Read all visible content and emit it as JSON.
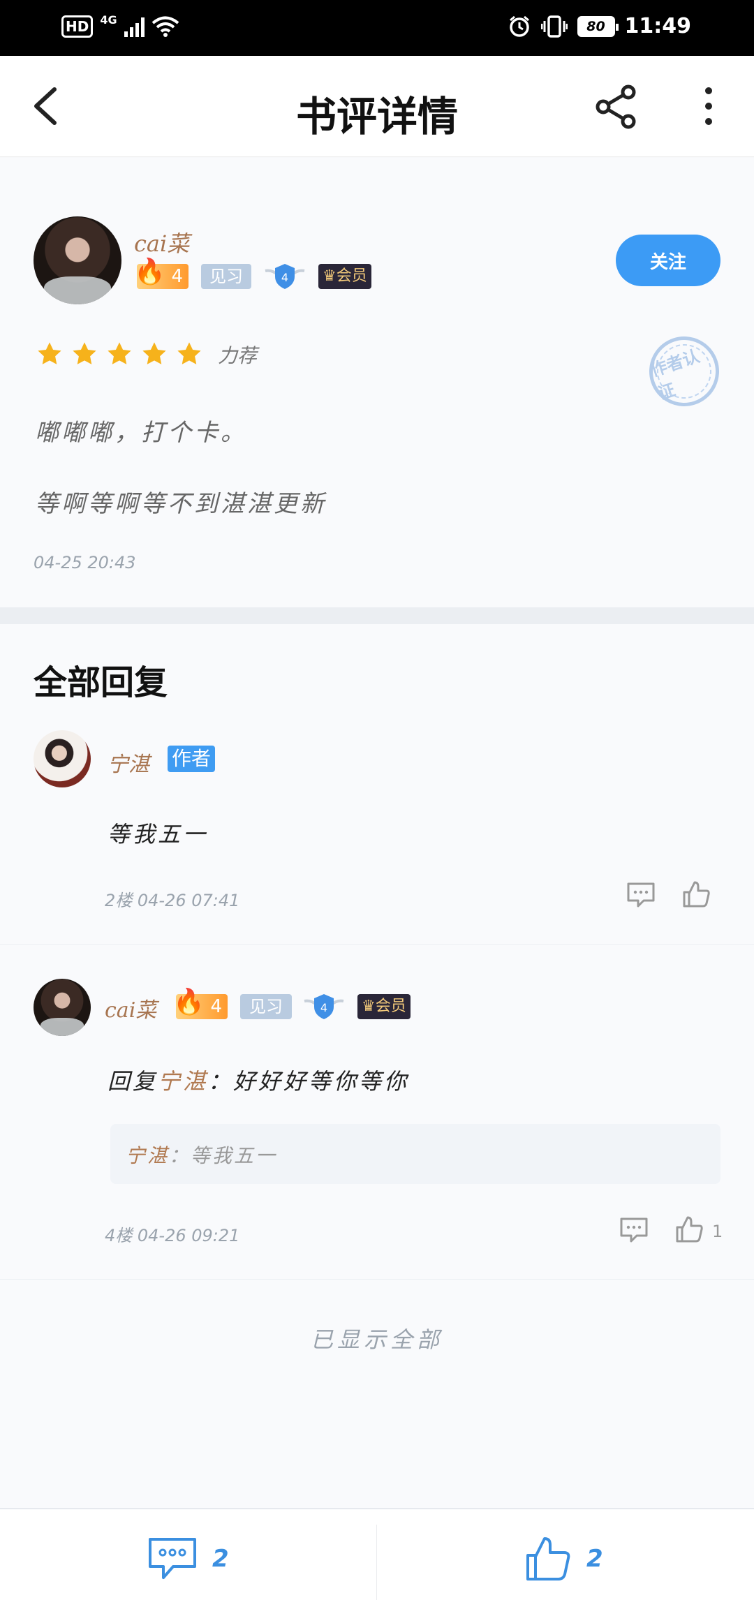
{
  "statusbar": {
    "hd": "HD",
    "network": "4G",
    "battery": "80",
    "time": "11:49"
  },
  "header": {
    "title": "书评详情"
  },
  "review": {
    "user": {
      "name": "cai菜",
      "fire_level": "4",
      "badge_jianxi": "见习",
      "shield_level": "4",
      "vip_label": "会员"
    },
    "follow_label": "关注",
    "rating_label": "力荐",
    "stamp_text": "作者认证",
    "lines": [
      "嘟嘟嘟，打个卡。",
      "等啊等啊等不到湛湛更新"
    ],
    "time": "04-25 20:43"
  },
  "replies": {
    "title": "全部回复",
    "items": [
      {
        "name": "宁湛",
        "tag": "作者",
        "text": "等我五一",
        "meta": "2楼  04-26 07:41",
        "likes": ""
      },
      {
        "name": "cai菜",
        "fire_level": "4",
        "badge_jianxi": "见习",
        "shield_level": "4",
        "vip_label": "会员",
        "reply_prefix": "回复",
        "reply_to": "宁湛",
        "reply_body": "：好好好等你等你",
        "quote_name": "宁湛",
        "quote_body": "：等我五一",
        "meta": "4楼  04-26 09:21",
        "likes": "1"
      }
    ],
    "all_shown": "已显示全部"
  },
  "bottombar": {
    "comment_count": "2",
    "like_count": "2"
  },
  "colors": {
    "accent": "#3c9bf5",
    "username": "#a7744f",
    "star": "#f6b21b"
  }
}
